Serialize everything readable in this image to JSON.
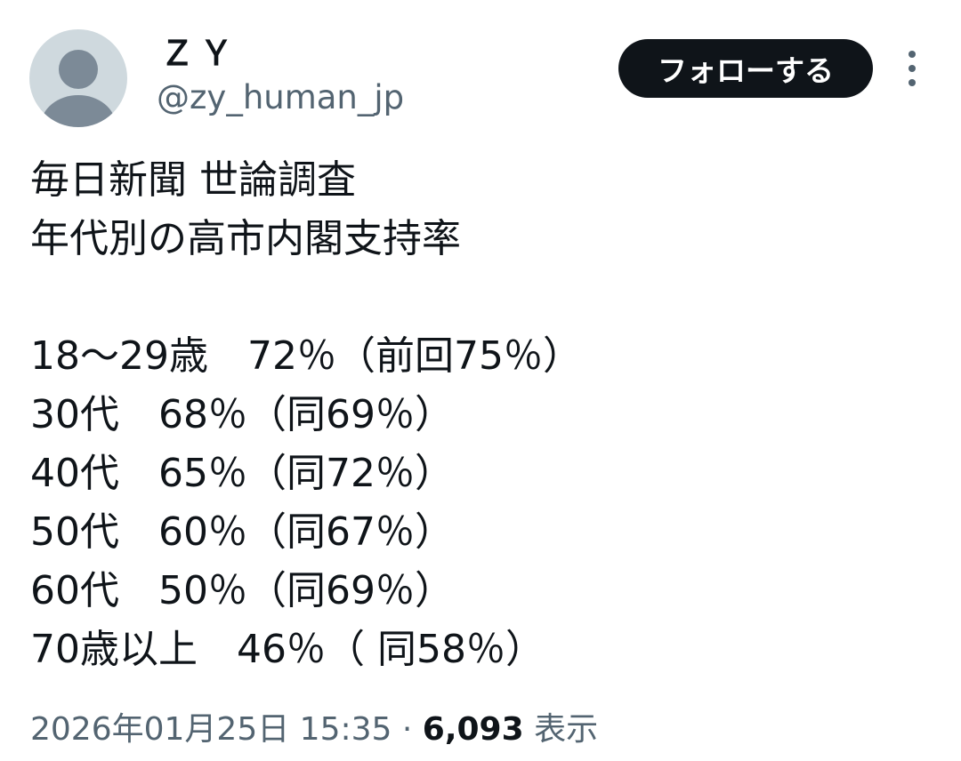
{
  "user": {
    "display_name": "ＺＹ",
    "handle": "@zy_human_jp",
    "avatar_icon": "default-avatar-icon",
    "avatar_bg": "#cfd9de",
    "avatar_fg": "#7c8a97"
  },
  "actions": {
    "follow_label": "フォローする",
    "more_icon": "more-vertical-icon"
  },
  "tweet": {
    "lines": [
      "毎日新聞 世論調査",
      "年代別の高市内閣支持率",
      "",
      "18～29歳　72％（前回75％）",
      "30代　68％（同69％）",
      "40代　65％（同72％）",
      "50代　60％（同67％）",
      "60代　50％（同69％）",
      "70歳以上　46％（ 同58％）"
    ]
  },
  "meta": {
    "timestamp": "2026年01月25日 15:35",
    "separator": " · ",
    "views_count": "6,093",
    "views_label": " 表示"
  },
  "colors": {
    "text": "#0f1419",
    "secondary": "#536471",
    "button_bg": "#0f1419",
    "button_text": "#ffffff"
  }
}
